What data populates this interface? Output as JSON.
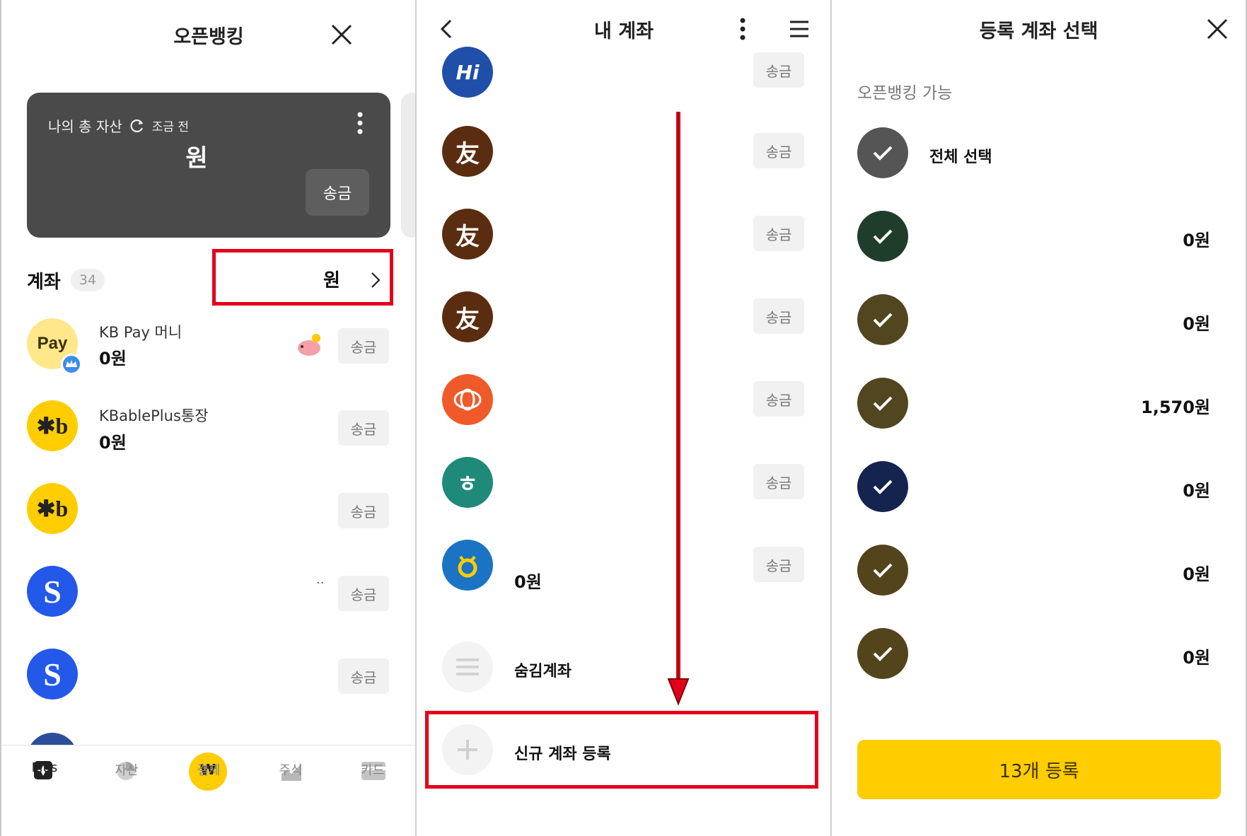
{
  "left": {
    "title": "오픈뱅킹",
    "asset_card": {
      "label": "나의 총 자산",
      "refresh_text": "조금 전",
      "amount": "원",
      "send_label": "송금"
    },
    "accounts": {
      "label": "계좌",
      "count": "34",
      "total": "원"
    },
    "rows": [
      {
        "name": "KB Pay 머니",
        "amount": "0원",
        "send": "송금",
        "logo": "Pay"
      },
      {
        "name": "KBablePlus통장",
        "amount": "0원",
        "send": "송금",
        "logo": "kb"
      },
      {
        "name": "",
        "amount": "",
        "send": "송금",
        "logo": "kb"
      },
      {
        "name": "",
        "amount": "",
        "send": "송금",
        "logo": "shinhan",
        "extra": "··"
      },
      {
        "name": "",
        "amount": "",
        "send": "송금",
        "logo": "shinhan"
      }
    ],
    "nav": [
      {
        "label": "Plus",
        "icon": "plus-star-icon"
      },
      {
        "label": "자산",
        "icon": "pie-chart-icon"
      },
      {
        "label": "결제",
        "icon": "won-scan-icon"
      },
      {
        "label": "주식",
        "icon": "stock-chart-icon"
      },
      {
        "label": "카드",
        "icon": "card-icon"
      }
    ]
  },
  "middle": {
    "title": "내 계좌",
    "rows": [
      {
        "send": "송금",
        "logo": "hi"
      },
      {
        "send": "송금",
        "logo": "woori"
      },
      {
        "send": "송금",
        "logo": "woori"
      },
      {
        "send": "송금",
        "logo": "woori"
      },
      {
        "send": "송금",
        "logo": "citi"
      },
      {
        "send": "송금",
        "logo": "hana"
      },
      {
        "send": "송금",
        "logo": "nonghyup",
        "amount": "0원"
      }
    ],
    "hidden_accounts": "숨김계좌",
    "new_account": "신규 계좌 등록"
  },
  "right": {
    "title": "등록 계좌 선택",
    "section_label": "오픈뱅킹 가능",
    "select_all": "전체 선택",
    "rows": [
      {
        "amount": "0원",
        "bg": "#1f3d2b"
      },
      {
        "amount": "0원",
        "bg": "#524620"
      },
      {
        "amount": "1,570원",
        "bg": "#524620"
      },
      {
        "amount": "0원",
        "bg": "#14244f"
      },
      {
        "amount": "0원",
        "bg": "#54441c"
      },
      {
        "amount": "0원",
        "bg": "#54441c"
      }
    ],
    "register_button": "13개 등록"
  },
  "colors": {
    "brand_yellow": "#FFCD00",
    "highlight_red": "#E3001B",
    "card_dark": "#4a4a4a"
  }
}
